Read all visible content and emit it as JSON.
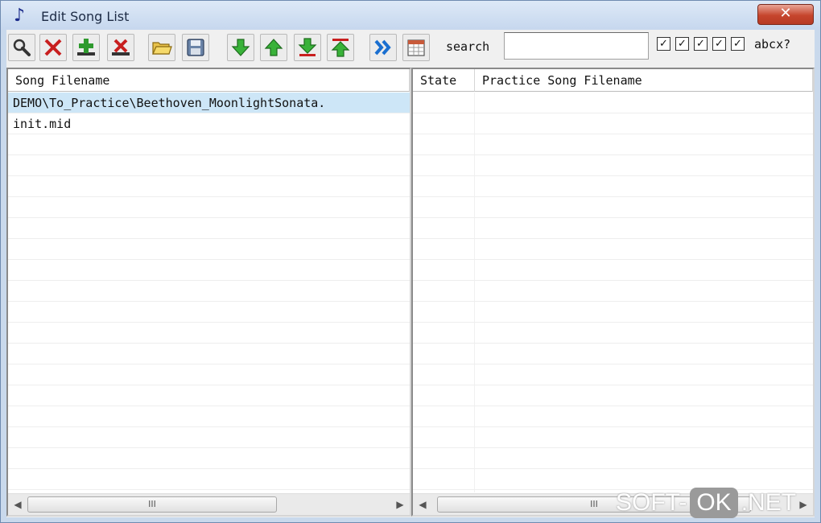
{
  "window": {
    "title": "Edit Song List",
    "close_label": "✕"
  },
  "toolbar": {
    "buttons": [
      {
        "name": "find-button",
        "icon": "magnifier-icon"
      },
      {
        "name": "delete-button",
        "icon": "red-x-icon"
      },
      {
        "name": "add-button",
        "icon": "green-plus-icon"
      },
      {
        "name": "remove-button",
        "icon": "small-red-x-icon"
      },
      {
        "name": "open-button",
        "icon": "folder-icon"
      },
      {
        "name": "save-button",
        "icon": "floppy-disk-icon"
      },
      {
        "name": "move-down-button",
        "icon": "green-down-arrow-icon"
      },
      {
        "name": "move-up-button",
        "icon": "green-up-arrow-icon"
      },
      {
        "name": "move-bottom-button",
        "icon": "green-down-to-bar-icon"
      },
      {
        "name": "move-top-button",
        "icon": "green-up-to-bar-icon"
      },
      {
        "name": "forward-button",
        "icon": "double-chevron-right-icon"
      },
      {
        "name": "calendar-button",
        "icon": "calendar-grid-icon"
      }
    ],
    "search_label": "search",
    "search_value": "",
    "checkbox_mark": "✓",
    "abcx_label": "abcx?"
  },
  "left_panel": {
    "header": "Song Filename",
    "rows": [
      "DEMO\\To_Practice\\Beethoven_MoonlightSonata.",
      "init.mid"
    ]
  },
  "right_panel": {
    "headers": {
      "state": "State",
      "practice_filename": "Practice Song Filename"
    }
  },
  "scrollbar": {
    "left_arrow": "◀",
    "right_arrow": "▶",
    "thumb_grip": "III"
  },
  "watermark": {
    "part1": "SOFT-",
    "part2": "OK",
    "part3": ".NET"
  },
  "colors": {
    "selection": "#cde6f7",
    "accent_green": "#2e9a2e",
    "accent_red": "#c81e1e",
    "accent_blue": "#1a6fd0"
  }
}
